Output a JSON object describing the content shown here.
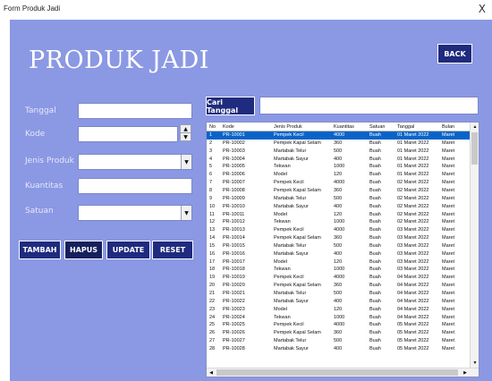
{
  "window": {
    "title": "Form Produk Jadi",
    "close_glyph": "X"
  },
  "header": {
    "title": "PRODUK JADI",
    "back_label": "BACK"
  },
  "form": {
    "tanggal_label": "Tanggal",
    "kode_label": "Kode",
    "jenis_label": "Jenis Produk",
    "kuantitas_label": "Kuantitas",
    "satuan_label": "Satuan"
  },
  "actions": {
    "tambah": "TAMBAH",
    "hapus": "HAPUS",
    "update": "UPDATE",
    "reset": "RESET"
  },
  "search": {
    "button_label": "Cari Tanggal",
    "value": ""
  },
  "icons": {
    "dropdown": "chevron-down-icon",
    "spin": "spin-updown-icon",
    "close": "close-icon"
  },
  "colors": {
    "form_bg": "#8b98e3",
    "button_bg": "#1f2b7e",
    "selected_row": "#0a64c8"
  },
  "table": {
    "headers": [
      "No",
      "Kode",
      "Jenis Produk",
      "Kuantitas",
      "Satuan",
      "Tanggal",
      "Bulan"
    ],
    "rows": [
      [
        "1",
        "PR-10001",
        "Pempek Kecil",
        "4000",
        "Buah",
        "01 Maret 2022",
        "Maret"
      ],
      [
        "2",
        "PR-10002",
        "Pempek Kapal Selam",
        "360",
        "Buah",
        "01 Maret 2022",
        "Maret"
      ],
      [
        "3",
        "PR-10003",
        "Martabak Telur",
        "500",
        "Buah",
        "01 Maret 2022",
        "Maret"
      ],
      [
        "4",
        "PR-10004",
        "Martabak Sayur",
        "400",
        "Buah",
        "01 Maret 2022",
        "Maret"
      ],
      [
        "5",
        "PR-10005",
        "Tekwan",
        "1000",
        "Buah",
        "01 Maret 2022",
        "Maret"
      ],
      [
        "6",
        "PR-10006",
        "Model",
        "120",
        "Buah",
        "01 Maret 2022",
        "Maret"
      ],
      [
        "7",
        "PR-10007",
        "Pempek Kecil",
        "4000",
        "Buah",
        "02 Maret 2022",
        "Maret"
      ],
      [
        "8",
        "PR-10008",
        "Pempek Kapal Selam",
        "360",
        "Buah",
        "02 Maret 2022",
        "Maret"
      ],
      [
        "9",
        "PR-10009",
        "Martabak Telur",
        "500",
        "Buah",
        "02 Maret 2022",
        "Maret"
      ],
      [
        "10",
        "PR-10010",
        "Martabak Sayur",
        "400",
        "Buah",
        "02 Maret 2022",
        "Maret"
      ],
      [
        "11",
        "PR-10011",
        "Model",
        "120",
        "Buah",
        "02 Maret 2022",
        "Maret"
      ],
      [
        "12",
        "PR-10012",
        "Tekwan",
        "1000",
        "Buah",
        "02 Maret 2022",
        "Maret"
      ],
      [
        "13",
        "PR-10013",
        "Pempek Kecil",
        "4000",
        "Buah",
        "03 Maret 2022",
        "Maret"
      ],
      [
        "14",
        "PR-10014",
        "Pempek Kapal Selam",
        "360",
        "Buah",
        "03 Maret 2022",
        "Maret"
      ],
      [
        "15",
        "PR-10015",
        "Martabak Telur",
        "500",
        "Buah",
        "03 Maret 2022",
        "Maret"
      ],
      [
        "16",
        "PR-10016",
        "Martabak Sayur",
        "400",
        "Buah",
        "03 Maret 2022",
        "Maret"
      ],
      [
        "17",
        "PR-10017",
        "Model",
        "120",
        "Buah",
        "03 Maret 2022",
        "Maret"
      ],
      [
        "18",
        "PR-10018",
        "Tekwan",
        "1000",
        "Buah",
        "03 Maret 2022",
        "Maret"
      ],
      [
        "19",
        "PR-10019",
        "Pempek Kecil",
        "4000",
        "Buah",
        "04 Maret 2022",
        "Maret"
      ],
      [
        "20",
        "PR-10020",
        "Pempek Kapal Selam",
        "360",
        "Buah",
        "04 Maret 2022",
        "Maret"
      ],
      [
        "21",
        "PR-10021",
        "Martabak Telur",
        "500",
        "Buah",
        "04 Maret 2022",
        "Maret"
      ],
      [
        "22",
        "PR-10022",
        "Martabak Sayur",
        "400",
        "Buah",
        "04 Maret 2022",
        "Maret"
      ],
      [
        "23",
        "PR-10023",
        "Model",
        "120",
        "Buah",
        "04 Maret 2022",
        "Maret"
      ],
      [
        "24",
        "PR-10024",
        "Tekwan",
        "1000",
        "Buah",
        "04 Maret 2022",
        "Maret"
      ],
      [
        "25",
        "PR-10025",
        "Pempek Kecil",
        "4000",
        "Buah",
        "05 Maret 2022",
        "Maret"
      ],
      [
        "26",
        "PR-10026",
        "Pempek Kapal Selam",
        "360",
        "Buah",
        "05 Maret 2022",
        "Maret"
      ],
      [
        "27",
        "PR-10027",
        "Martabak Telur",
        "500",
        "Buah",
        "05 Maret 2022",
        "Maret"
      ],
      [
        "28",
        "PR-10028",
        "Martabak Sayur",
        "400",
        "Buah",
        "05 Maret 2022",
        "Maret"
      ]
    ]
  }
}
